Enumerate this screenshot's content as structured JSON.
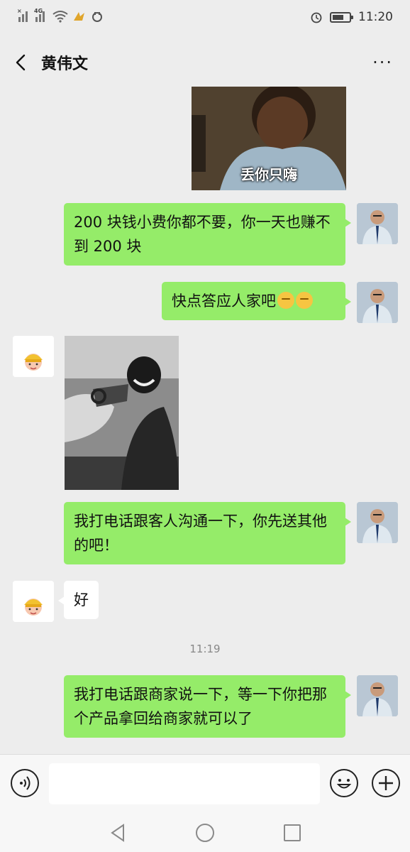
{
  "status_bar": {
    "time": "11:20",
    "network": "4G",
    "icons": [
      "signal-x-icon",
      "signal-4g-icon",
      "wifi-icon",
      "notification-icon",
      "app-icon",
      "alarm-icon",
      "battery-icon"
    ]
  },
  "header": {
    "title": "黄伟文",
    "back_icon": "chevron-left-icon",
    "more_label": "···"
  },
  "messages": [
    {
      "type": "image",
      "side": "self",
      "caption": "丢你只嗨"
    },
    {
      "type": "text",
      "side": "self",
      "text": "200 块钱小费你都不要，你一天也赚不到 200 块"
    },
    {
      "type": "text",
      "side": "self",
      "text": "快点答应人家吧",
      "emojis": [
        "thinking-emoji",
        "thinking-emoji"
      ]
    },
    {
      "type": "image",
      "side": "other",
      "caption": ""
    },
    {
      "type": "text",
      "side": "self",
      "text": "我打电话跟客人沟通一下，你先送其他的吧！"
    },
    {
      "type": "text",
      "side": "other",
      "text": "好"
    },
    {
      "type": "timestamp",
      "text": "11:19"
    },
    {
      "type": "text",
      "side": "self",
      "text": "我打电话跟商家说一下，等一下你把那个产品拿回给商家就可以了"
    }
  ],
  "input_bar": {
    "placeholder": "",
    "voice_icon": "voice-icon",
    "emoji_icon": "emoji-icon",
    "plus_icon": "plus-icon"
  },
  "system_nav": {
    "icons": [
      "back-triangle-icon",
      "home-circle-icon",
      "recent-square-icon"
    ]
  },
  "colors": {
    "background": "#ededed",
    "self_bubble": "#95ec69",
    "other_bubble": "#ffffff",
    "timestamp": "#888888"
  }
}
